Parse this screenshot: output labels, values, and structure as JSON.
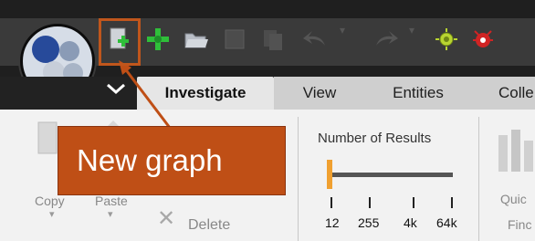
{
  "window": {
    "title": ""
  },
  "quickbar": {
    "icons": [
      "new-graph-icon",
      "add-entity-icon",
      "open-folder-icon",
      "save-icon",
      "copy-icon",
      "undo-icon",
      "redo-icon",
      "settings-bug-icon",
      "delete-bug-icon"
    ]
  },
  "tabs": {
    "investigate": "Investigate",
    "view": "View",
    "entities": "Entities",
    "collections": "Colle"
  },
  "ribbon": {
    "copy_label": "Copy",
    "paste_label": "Paste",
    "delete_label": "Delete",
    "number_of_results": "Number of Results",
    "slider_ticks": [
      "12",
      "255",
      "4k",
      "64k"
    ],
    "slider_value": "12",
    "quick_label": "Quic",
    "find_label": "Finc"
  },
  "callout": {
    "text": "New graph"
  },
  "colors": {
    "accent": "#bf4f16",
    "tab_active_bg": "#e6e6e6",
    "dark_bg": "#1f1f1f",
    "slider_thumb": "#f0a030",
    "green_icon": "#2fbf3a",
    "red_bug": "#d02424"
  }
}
